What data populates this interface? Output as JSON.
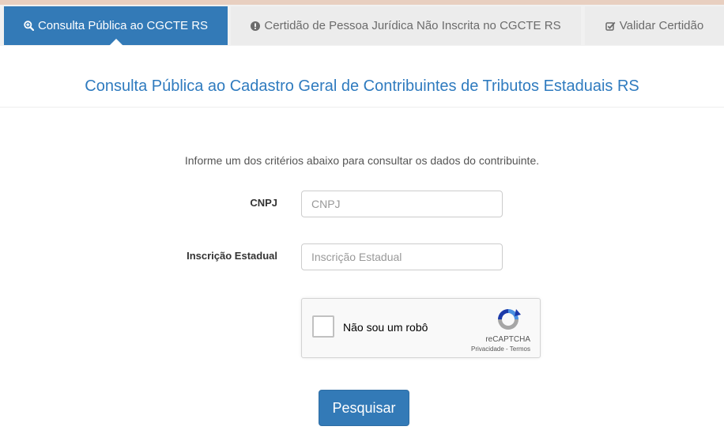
{
  "tabs": [
    {
      "label": "Consulta Pública ao CGCTE RS",
      "icon": "search-plus-icon",
      "active": true
    },
    {
      "label": "Certidão de Pessoa Jurídica Não Inscrita no CGCTE RS",
      "icon": "exclamation-circle-icon",
      "active": false
    },
    {
      "label": "Validar Certidão",
      "icon": "check-square-icon",
      "active": false
    }
  ],
  "page": {
    "title": "Consulta Pública ao Cadastro Geral de Contribuintes de Tributos Estaduais RS",
    "instructions": "Informe um dos critérios abaixo para consultar os dados do contribuinte."
  },
  "form": {
    "cnpj": {
      "label": "CNPJ",
      "value": "",
      "placeholder": "CNPJ"
    },
    "inscricao": {
      "label": "Inscrição Estadual",
      "value": "",
      "placeholder": "Inscrição Estadual"
    }
  },
  "captcha": {
    "label": "Não sou um robô",
    "brand": "reCAPTCHA",
    "privacy": "Privacidade",
    "separator": " - ",
    "terms": "Termos"
  },
  "submit_label": "Pesquisar",
  "colors": {
    "primary": "#337ab7",
    "title": "#2f7bbf"
  }
}
